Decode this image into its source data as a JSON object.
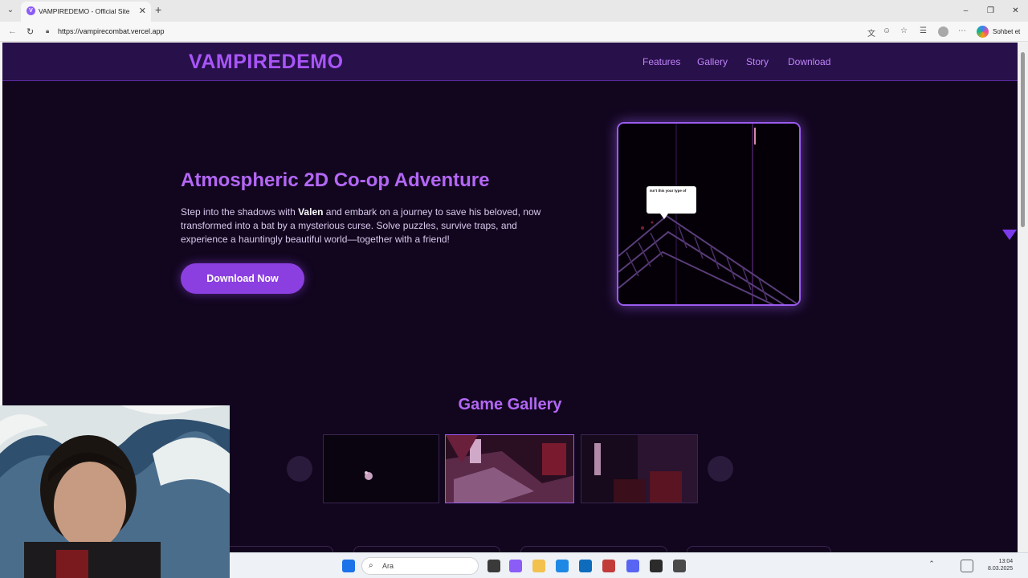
{
  "browser": {
    "tab_title": "VAMPIREDEMO - Official Site",
    "favicon_letter": "V",
    "url": "https://vampirecombat.vercel.app",
    "profile_button_label": "Sohbet et"
  },
  "site": {
    "logo": "VAMPIREDEMO",
    "nav": [
      "Features",
      "Gallery",
      "Story",
      "Download"
    ]
  },
  "hero": {
    "title": "Atmospheric 2D Co-op Adventure",
    "text_before": "Step into the shadows with ",
    "text_bold": "Valen",
    "text_after": " and embark on a journey to save his beloved, now transformed into a bat by a mysterious curse. Solve puzzles, survive traps, and experience a hauntingly beautiful world—together with a friend!",
    "button": "Download Now",
    "speech_bubble": "Isn't this your type of"
  },
  "gallery": {
    "title": "Game Gallery"
  },
  "taskbar": {
    "search_placeholder": "Ara",
    "time": "13:04",
    "date": "8.03.2025"
  },
  "colors": {
    "accent": "#a855f7",
    "page_bg": "#12061f",
    "nav_bg": "#28104a",
    "button": "#8b3fe0"
  },
  "icons": [
    "search-icon",
    "close-icon",
    "plus-icon",
    "back-icon",
    "reload-icon",
    "lock-icon",
    "star-icon",
    "more-icon",
    "windows-icon",
    "chevron-down-icon"
  ]
}
